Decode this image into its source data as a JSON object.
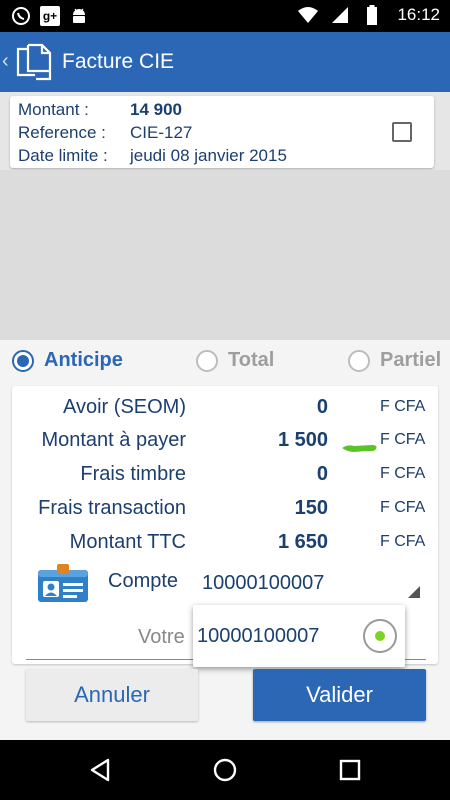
{
  "status_bar": {
    "time": "16:12",
    "icons_left": [
      "whatsapp-icon",
      "google-plus-icon",
      "android-icon"
    ],
    "icons_right": [
      "wifi-icon",
      "signal-icon",
      "battery-icon"
    ]
  },
  "app_bar": {
    "title": "Facture CIE"
  },
  "invoice": {
    "montant_label": "Montant :",
    "montant_value": "14 900",
    "reference_label": "Reference :",
    "reference_value": "CIE-127",
    "date_label": "Date limite :",
    "date_value": "jeudi 08 janvier 2015",
    "checked": false
  },
  "payment_type": {
    "options": [
      {
        "label": "Anticipe",
        "selected": true
      },
      {
        "label": "Total",
        "selected": false
      },
      {
        "label": "Partiel",
        "selected": false
      }
    ]
  },
  "payment": {
    "rows": [
      {
        "label": "Avoir (SEOM)",
        "value": "0",
        "currency": "F CFA"
      },
      {
        "label": "Montant à payer",
        "value": "1 500",
        "currency": "F CFA"
      },
      {
        "label": "Frais timbre",
        "value": "0",
        "currency": "F CFA"
      },
      {
        "label": "Frais transaction",
        "value": "150",
        "currency": "F CFA"
      },
      {
        "label": "Montant TTC",
        "value": "1 650",
        "currency": "F CFA"
      }
    ],
    "compte_label": "Compte",
    "compte_value": "10000100007",
    "votre_placeholder": "Votre"
  },
  "dropdown": {
    "option": "10000100007"
  },
  "buttons": {
    "cancel": "Annuler",
    "ok": "Valider"
  },
  "colors": {
    "primary": "#2b67b4",
    "text": "#1b3f6e",
    "accent_green": "#7ed321"
  }
}
